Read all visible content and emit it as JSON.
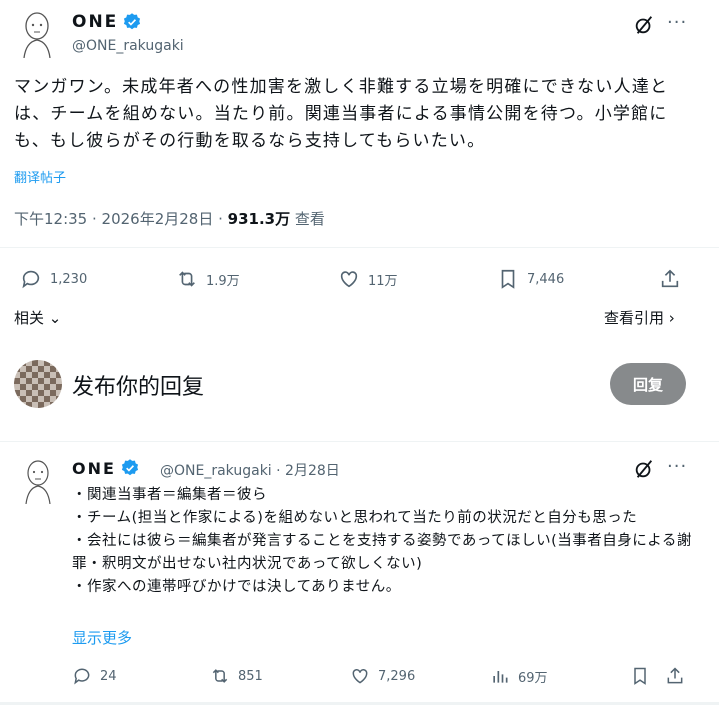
{
  "tweet": {
    "display_name": "ONE",
    "handle": "@ONE_rakugaki",
    "more_label": "···",
    "text": "マンガワン。未成年者への性加害を激しく非難する立場を明確にできない人達とは、チームを組めない。当たり前。関連当事者による事情公開を待つ。小学館にも、もし彼らがその行動を取るなら支持してもらいたい。",
    "translate_label": "翻译帖子",
    "timestamp_prefix": "下午12:35 · 2026年2月28日 · ",
    "views_count": "931.3万",
    "views_label": " 查看",
    "stats": {
      "replies": "1,230",
      "retweets": "1.9万",
      "likes": "11万",
      "bookmarks": "7,446"
    },
    "related_label": "相关",
    "quotes_label": "查看引用"
  },
  "composer": {
    "placeholder": "发布你的回复",
    "reply_button": "回复"
  },
  "reply": {
    "display_name": "ONE",
    "meta": "@ONE_rakugaki · 2月28日",
    "more_label": "···",
    "lines": [
      "・関連当事者＝編集者＝彼ら",
      "・チーム(担当と作家による)を組めないと思われて当たり前の状況だと自分も思った",
      "・会社には彼ら＝編集者が発言することを支持する姿勢であってほしい(当事者自身による謝罪・釈明文が出せない社内状況であって欲しくない)",
      "・作家への連帯呼びかけでは決してありません。"
    ],
    "show_more": "显示更多",
    "stats": {
      "replies": "24",
      "retweets": "851",
      "likes": "7,296",
      "views": "69万"
    }
  },
  "colors": {
    "verified": "#1d9bf0",
    "link": "#1d9bf0",
    "muted": "#536471",
    "reply_button": "#878a8c"
  }
}
